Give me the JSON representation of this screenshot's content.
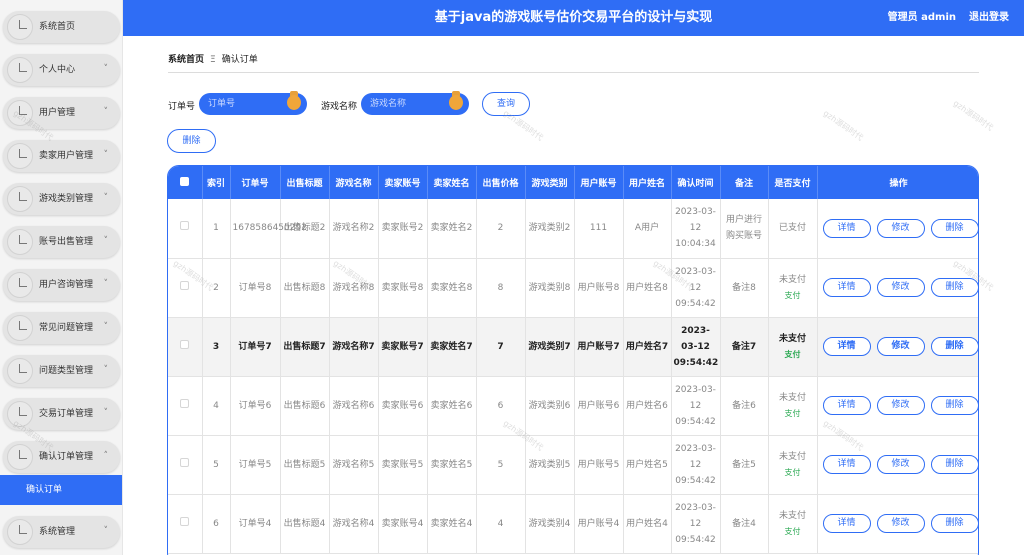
{
  "header": {
    "title": "基于java的游戏账号估价交易平台的设计与实现",
    "admin": "管理员 admin",
    "logout": "退出登录"
  },
  "sidebar": {
    "items": [
      {
        "label": "系统首页",
        "chevron": ""
      },
      {
        "label": "个人中心",
        "chevron": "˅"
      },
      {
        "label": "用户管理",
        "chevron": "˅"
      },
      {
        "label": "卖家用户管理",
        "chevron": "˅"
      },
      {
        "label": "游戏类别管理",
        "chevron": "˅"
      },
      {
        "label": "账号出售管理",
        "chevron": "˅"
      },
      {
        "label": "用户咨询管理",
        "chevron": "˅"
      },
      {
        "label": "常见问题管理",
        "chevron": "˅"
      },
      {
        "label": "问题类型管理",
        "chevron": "˅"
      },
      {
        "label": "交易订单管理",
        "chevron": "˅"
      },
      {
        "label": "确认订单管理",
        "chevron": "˄"
      },
      {
        "label": "系统管理",
        "chevron": "˅"
      }
    ],
    "active_sub": "确认订单"
  },
  "breadcrumb": {
    "home": "系统首页",
    "sep": "Ξ",
    "current": "确认订单"
  },
  "search": {
    "order_label": "订单号",
    "order_placeholder": "订单号",
    "game_label": "游戏名称",
    "game_placeholder": "游戏名称",
    "query_button": "查询",
    "delete_button": "删除"
  },
  "table": {
    "headers": [
      "索引",
      "订单号",
      "出售标题",
      "游戏名称",
      "卖家账号",
      "卖家姓名",
      "出售价格",
      "游戏类别",
      "用户账号",
      "用户姓名",
      "确认时间",
      "备注",
      "是否支付",
      "操作"
    ],
    "rows": [
      {
        "index": "1",
        "order": "1678586450292",
        "title": "出售标题2",
        "game": "游戏名称2",
        "seller_acc": "卖家账号2",
        "seller_name": "卖家姓名2",
        "price": "2",
        "category": "游戏类别2",
        "user_acc": "111",
        "user_name": "A用户",
        "time": "2023-03-12 10:04:34",
        "note": "用户进行购买账号",
        "status": "已支付",
        "pay_link": ""
      },
      {
        "index": "2",
        "order": "订单号8",
        "title": "出售标题8",
        "game": "游戏名称8",
        "seller_acc": "卖家账号8",
        "seller_name": "卖家姓名8",
        "price": "8",
        "category": "游戏类别8",
        "user_acc": "用户账号8",
        "user_name": "用户姓名8",
        "time": "2023-03-12 09:54:42",
        "note": "备注8",
        "status": "未支付",
        "pay_link": "支付"
      },
      {
        "index": "3",
        "order": "订单号7",
        "title": "出售标题7",
        "game": "游戏名称7",
        "seller_acc": "卖家账号7",
        "seller_name": "卖家姓名7",
        "price": "7",
        "category": "游戏类别7",
        "user_acc": "用户账号7",
        "user_name": "用户姓名7",
        "time": "2023-03-12 09:54:42",
        "note": "备注7",
        "status": "未支付",
        "pay_link": "支付"
      },
      {
        "index": "4",
        "order": "订单号6",
        "title": "出售标题6",
        "game": "游戏名称6",
        "seller_acc": "卖家账号6",
        "seller_name": "卖家姓名6",
        "price": "6",
        "category": "游戏类别6",
        "user_acc": "用户账号6",
        "user_name": "用户姓名6",
        "time": "2023-03-12 09:54:42",
        "note": "备注6",
        "status": "未支付",
        "pay_link": "支付"
      },
      {
        "index": "5",
        "order": "订单号5",
        "title": "出售标题5",
        "game": "游戏名称5",
        "seller_acc": "卖家账号5",
        "seller_name": "卖家姓名5",
        "price": "5",
        "category": "游戏类别5",
        "user_acc": "用户账号5",
        "user_name": "用户姓名5",
        "time": "2023-03-12 09:54:42",
        "note": "备注5",
        "status": "未支付",
        "pay_link": "支付"
      },
      {
        "index": "6",
        "order": "订单号4",
        "title": "出售标题4",
        "game": "游戏名称4",
        "seller_acc": "卖家账号4",
        "seller_name": "卖家姓名4",
        "price": "4",
        "category": "游戏类别4",
        "user_acc": "用户账号4",
        "user_name": "用户姓名4",
        "time": "2023-03-12 09:54:42",
        "note": "备注4",
        "status": "未支付",
        "pay_link": "支付"
      }
    ],
    "actions": {
      "detail": "详情",
      "edit": "修改",
      "delete": "删除"
    }
  },
  "watermark": "gzh源码时代"
}
